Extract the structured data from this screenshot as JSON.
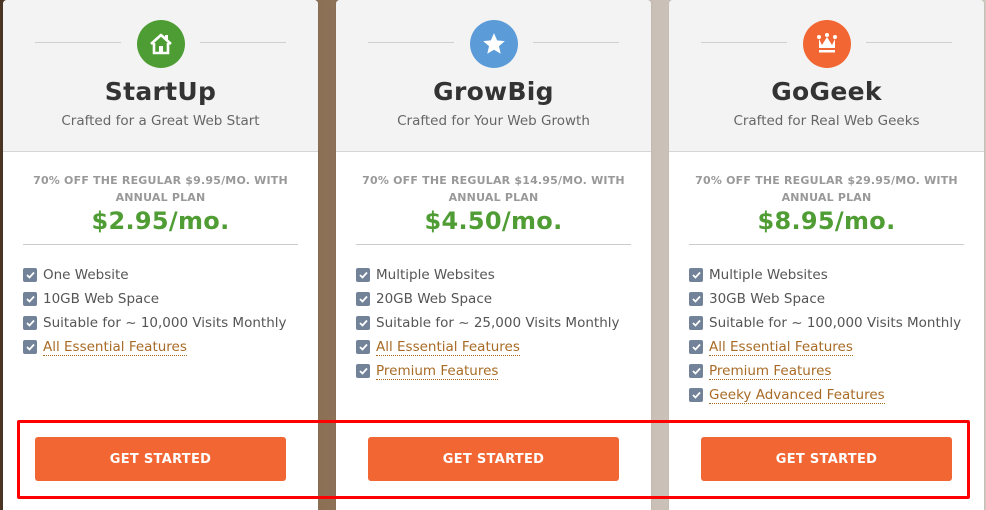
{
  "plans": [
    {
      "name": "StartUp",
      "tagline": "Crafted for a Great Web Start",
      "icon": "house-icon",
      "icon_color": "#4e9d34",
      "promo": "70% OFF THE REGULAR $9.95/MO. WITH ANNUAL PLAN",
      "price": "$2.95/mo.",
      "features": [
        {
          "label": "One Website",
          "link": false
        },
        {
          "label": "10GB Web Space",
          "link": false
        },
        {
          "label": "Suitable for ~ 10,000 Visits Monthly",
          "link": false
        },
        {
          "label": "All Essential Features",
          "link": true
        }
      ],
      "cta": "GET STARTED"
    },
    {
      "name": "GrowBig",
      "tagline": "Crafted for Your Web Growth",
      "icon": "star-icon",
      "icon_color": "#5b9bd8",
      "promo": "70% OFF THE REGULAR $14.95/MO. WITH ANNUAL PLAN",
      "price": "$4.50/mo.",
      "features": [
        {
          "label": "Multiple Websites",
          "link": false
        },
        {
          "label": "20GB Web Space",
          "link": false
        },
        {
          "label": "Suitable for ~ 25,000 Visits Monthly",
          "link": false
        },
        {
          "label": "All Essential Features",
          "link": true
        },
        {
          "label": "Premium Features",
          "link": true
        }
      ],
      "cta": "GET STARTED"
    },
    {
      "name": "GoGeek",
      "tagline": "Crafted for Real Web Geeks",
      "icon": "crown-icon",
      "icon_color": "#f26634",
      "promo": "70% OFF THE REGULAR $29.95/MO. WITH ANNUAL PLAN",
      "price": "$8.95/mo.",
      "features": [
        {
          "label": "Multiple Websites",
          "link": false
        },
        {
          "label": "30GB Web Space",
          "link": false
        },
        {
          "label": "Suitable for ~ 100,000 Visits Monthly",
          "link": false
        },
        {
          "label": "All Essential Features",
          "link": true
        },
        {
          "label": "Premium Features",
          "link": true
        },
        {
          "label": "Geeky Advanced Features",
          "link": true
        }
      ],
      "cta": "GET STARTED"
    }
  ],
  "colors": {
    "price_green": "#4f9d34",
    "cta_orange": "#f26634",
    "link_brown": "#a86b26",
    "checkbox": "#718299",
    "highlight_red": "#ff0000"
  }
}
